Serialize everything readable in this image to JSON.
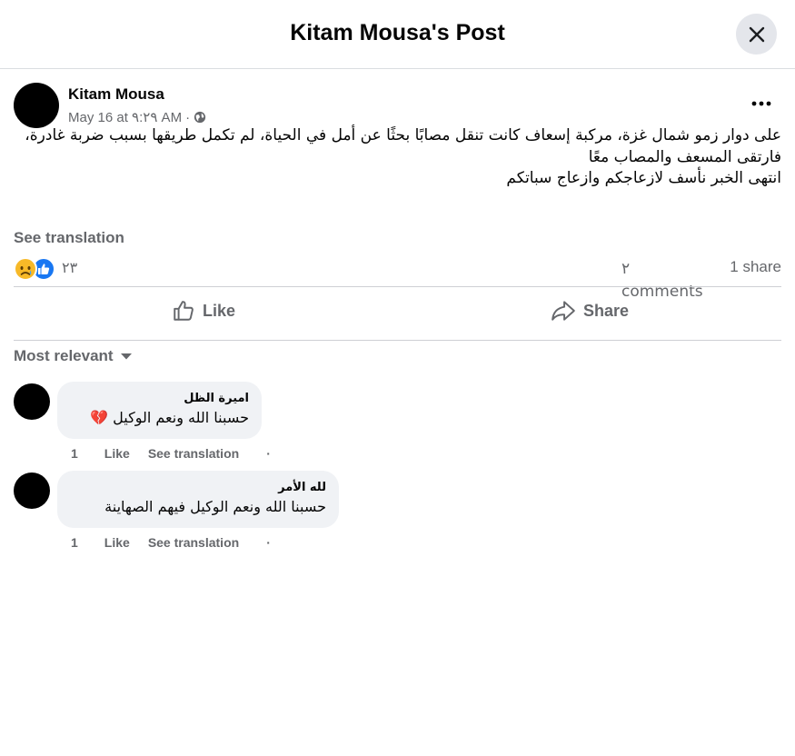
{
  "modal": {
    "title": "Kitam Mousa's Post",
    "close_icon": "close-icon"
  },
  "post": {
    "author": "Kitam Mousa",
    "date": "May 16 at ٩:٢٩ AM",
    "separator": "·",
    "privacy_icon": "globe-icon",
    "more_icon": "more-horizontal-icon",
    "lines": [
      "على دوار زمو شمال غزة، مركبة إسعاف كانت تنقل مصابًا بحثًا عن أمل في الحياة، لم تكمل طريقها بسبب ضربة غادرة،",
      "فارتقى المسعف والمصاب معًا",
      "انتهى الخبر نأسف لازعاجكم وازعاج سباتكم"
    ],
    "see_translation": "See translation",
    "reactions": {
      "icons": [
        "sad-face-icon",
        "like-thumb-icon"
      ],
      "count": "٢٣",
      "comments": "٢ comments",
      "shares": "1 share"
    },
    "actions": {
      "like": "Like",
      "share": "Share"
    }
  },
  "comments_section": {
    "sort_label": "Most relevant",
    "sort_icon": "caret-down-icon",
    "comments": [
      {
        "author": "اميرة الظل",
        "text": "حسبنا الله ونعم الوكيل 💔",
        "time": "1",
        "like": "Like",
        "translate": "See translation",
        "dot": "·"
      },
      {
        "author": "لله الأمر",
        "text": "حسبنا الله ونعم الوكيل فيهم الصهاينة",
        "time": "1",
        "like": "Like",
        "translate": "See translation",
        "dot": "·"
      }
    ]
  },
  "colors": {
    "text_primary": "#050505",
    "text_secondary": "#65676b",
    "divider": "#ced0d4",
    "bubble": "#f0f2f5",
    "like_blue": "#1877f2",
    "sad_yellow": "#f7b928"
  }
}
